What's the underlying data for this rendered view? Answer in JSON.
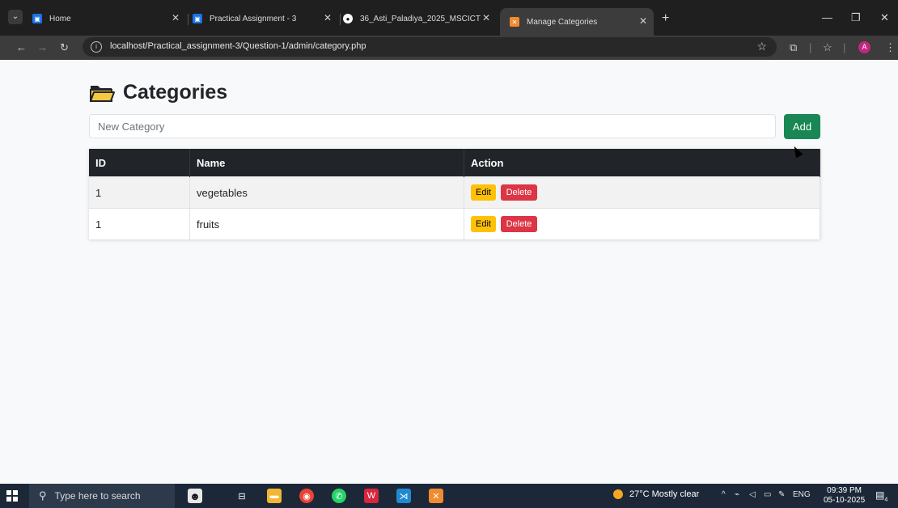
{
  "browser": {
    "tabs": [
      {
        "title": "Home",
        "color": "#1a73e8"
      },
      {
        "title": "Practical Assignment - 3",
        "color": "#1a73e8"
      },
      {
        "title": "36_Asti_Paladiya_2025_MSCICT",
        "color": "#ffffff"
      },
      {
        "title": "Manage Categories",
        "color": "#f28b30",
        "active": true
      }
    ],
    "url_host": "localhost",
    "url_path": "/Practical_assignment-3/Question-1/admin/category.php",
    "avatar_letter": "A"
  },
  "page": {
    "title": "Categories",
    "input_placeholder": "New Category",
    "add_label": "Add",
    "table": {
      "headers": [
        "ID",
        "Name",
        "Action"
      ],
      "rows": [
        {
          "id": "1",
          "name": "vegetables"
        },
        {
          "id": "1",
          "name": "fruits"
        }
      ],
      "edit_label": "Edit",
      "delete_label": "Delete"
    }
  },
  "taskbar": {
    "search_placeholder": "Type here to search",
    "weather": "27°C  Mostly clear",
    "lang": "ENG",
    "time": "09:39 PM",
    "date": "05-10-2025",
    "notif_count": "4"
  }
}
